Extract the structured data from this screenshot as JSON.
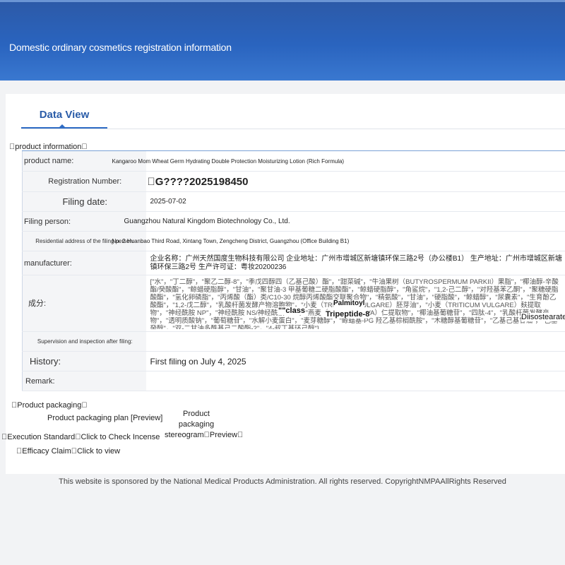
{
  "header": {
    "title": "Domestic ordinary cosmetics registration information"
  },
  "tabs": [
    {
      "label": "Data View"
    }
  ],
  "product_info": {
    "section_title": "\u0000product information\u0000",
    "rows": {
      "product_name": {
        "label": "product name:",
        "value": "Kangaroo Mom Wheat Germ Hydrating Double Protection Moisturizing Lotion (Rich Formula)"
      },
      "registration_number": {
        "label": "Registration Number:",
        "value": "\u0000G????2025198450"
      },
      "filing_date": {
        "label": "Filing date:",
        "value": "2025-07-02"
      },
      "filing_person": {
        "label": "Filing person:",
        "value": "Guangzhou Natural Kingdom Biotechnology Co., Ltd."
      },
      "residential_address": {
        "label": "Residential address of the filing person:",
        "value": "No. 2 Huanbao Third Road, Xintang Town, Zengcheng District, Guangzhou (Office Building B1)"
      },
      "manufacturer": {
        "label": "manufacturer:",
        "value": "企业名称：广州天然国度生物科技有限公司 企业地址：广州市增城区新塘镇环保三路2号（办公楼B1） 生产地址：广州市增城区新塘镇环保三路2号 生产许可证：粤妆20200236"
      },
      "ingredients": {
        "label": "成分:",
        "value": "[\"水\"，\"丁二醇\"，\"聚乙二醇-8\"，\"季戊四醇四（乙基己酸）酯\"，\"甜菜碱\"，\"牛油果树（BUTYROSPERMUM PARKII）果脂\"，\"椰油醇-辛酸酯/癸酸酯\"，\"鲸蜡硬脂醇\"，\"甘油\"，\"聚甘油-3 甲基葡糖二硬脂酸酯\"，\"鲸蜡硬脂醇\"，\"角鲨烷\"，\"1,2-己二醇\"，\"对羟基苯乙酮\"，\"聚糖硬脂酸酯\"，\"氢化卵磷脂\"，\"丙烯酸（酯）类/C10-30 烷醇丙烯酸酯交联聚合物\"，\"精氨酸\"，\"甘油\"，\"硬脂酸\"，\"鲸蜡醇\"，\"尿囊素\"，\"生育酚乙酸酯\"，\"1,2-戊二醇\"，\"乳酸杆菌发酵产物溶胞物\"，\"小麦（TRITICUM VULGARE）胚芽油\"，\"小麦（TRITICUM VULGARE）麸提取物\"，\"神经酰胺 NP\"，\"神经酰胺 NS/神经酰胺 NG\"，\"燕麦（AVENA SATIVA）仁提取物\"，\"椰油基葡糖苷\"，\"四肽-4\"，\"乳酸杆菌发酵产物\"，\"透明质酸钠\"，\"葡萄糖苷\"，\"水解小麦蛋白\"，\"麦芽糖醇\"，\"鲸蜡基-PG 羟乙基棕榈酰胺\"，\"木糖醇基葡糖苷\"，\"乙基己基甘油\"，\"己基癸醇\"，\"双-二甘油多酰基己二酸酯-2\"，\"4-叔丁基环己醇\"]",
        "overlays": {
          "class": "\"\"class",
          "palmitoyl": "Palmitoyl",
          "tripeptide": "Tripeptide-8",
          "diisostearate": "Diisostearate"
        }
      },
      "supervision": {
        "label": "Supervision and inspection after filing:",
        "value": ""
      },
      "history": {
        "label": "History:",
        "value": "First filing on July 4, 2025"
      },
      "remark": {
        "label": "Remark:",
        "value": ""
      }
    }
  },
  "packaging": {
    "section_title": "\u0000Product packaging\u0000",
    "plan_label": "Product packaging plan [Preview]",
    "stereogram_label": "Product packaging stereogram\u0000Preview\u0000"
  },
  "execution_standard": {
    "label": "\u0000Execution Standard\u0000",
    "link": "Click to Check Incense"
  },
  "efficacy_claim": {
    "label": "\u0000Efficacy Claim\u0000",
    "link": "Click to view"
  },
  "footer": {
    "text": "This website is sponsored by the National Medical Products Administration. All rights reserved. CopyrightNMPAAllRights Reserved"
  },
  "colors": {
    "banner": "#2a64bf",
    "accent": "#2f6cc4",
    "label_bg": "#f4f5f7"
  }
}
